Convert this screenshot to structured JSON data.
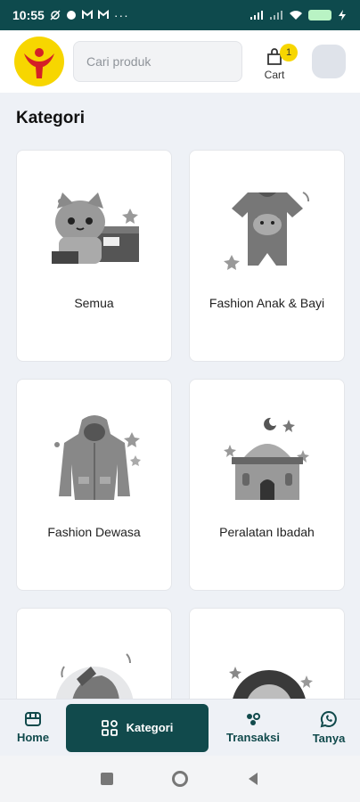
{
  "status_bar": {
    "time": "10:55"
  },
  "header": {
    "search_placeholder": "Cari produk",
    "cart_label": "Cart",
    "cart_count": "1"
  },
  "section": {
    "title": "Kategori"
  },
  "categories": [
    {
      "label": "Semua",
      "icon": "cat-box-icon"
    },
    {
      "label": "Fashion Anak & Bayi",
      "icon": "baby-clothes-icon"
    },
    {
      "label": "Fashion Dewasa",
      "icon": "jacket-icon"
    },
    {
      "label": "Peralatan Ibadah",
      "icon": "mosque-icon"
    },
    {
      "label": "",
      "icon": "helmet-icon"
    },
    {
      "label": "",
      "icon": "tire-icon"
    }
  ],
  "bottom_nav": {
    "home": "Home",
    "kategori": "Kategori",
    "transaksi": "Transaksi",
    "tanya": "Tanya"
  },
  "colors": {
    "primary": "#114a4c",
    "accent": "#f7d600",
    "background": "#eef1f6"
  }
}
